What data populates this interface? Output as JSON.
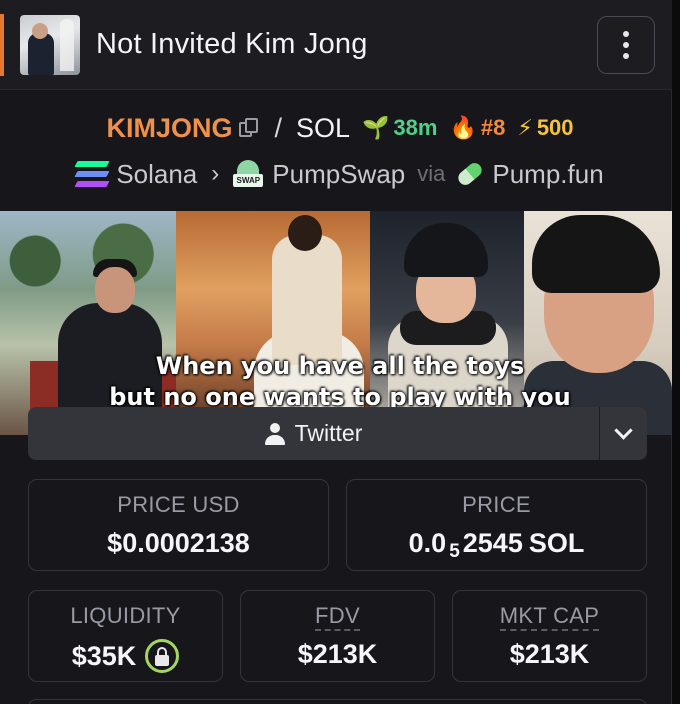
{
  "header": {
    "title": "Not Invited Kim Jong",
    "avatar_icon": "kim-jong-avatar",
    "menu_icon": "more-vertical-icon"
  },
  "token": {
    "symbol": "KIMJONG",
    "separator": "/",
    "quote": "SOL",
    "age": "38m",
    "rank": "#8",
    "boosts": "500",
    "age_icon": "seedling-icon",
    "rank_icon": "flame-icon",
    "boost_icon": "lightning-icon"
  },
  "chain": {
    "name": "Solana",
    "dex": "PumpSwap",
    "dex_icon_label": "SWAP",
    "via": "via",
    "launchpad": "Pump.fun"
  },
  "banner": {
    "caption_line1": "When you have all the toys",
    "caption_line2": "but no one wants to play with you"
  },
  "socials": {
    "twitter_label": "Twitter"
  },
  "stats": {
    "price_usd_label": "PRICE USD",
    "price_usd_value": "$0.0002138",
    "price_native_label": "PRICE",
    "price_native_prefix": "0.0",
    "price_native_zeros": "5",
    "price_native_digits": "2545",
    "price_native_unit": "SOL",
    "liquidity_label": "LIQUIDITY",
    "liquidity_value": "$35K",
    "fdv_label": "FDV",
    "fdv_value": "$213K",
    "mcap_label": "MKT CAP",
    "mcap_value": "$213K"
  },
  "colors": {
    "symbol": "#f0914b",
    "age": "#4fd18a",
    "rank": "#f58b3a",
    "boost": "#f5c33a",
    "lock_ring": "#a4d65e",
    "accent_bar": "#e9782c"
  }
}
